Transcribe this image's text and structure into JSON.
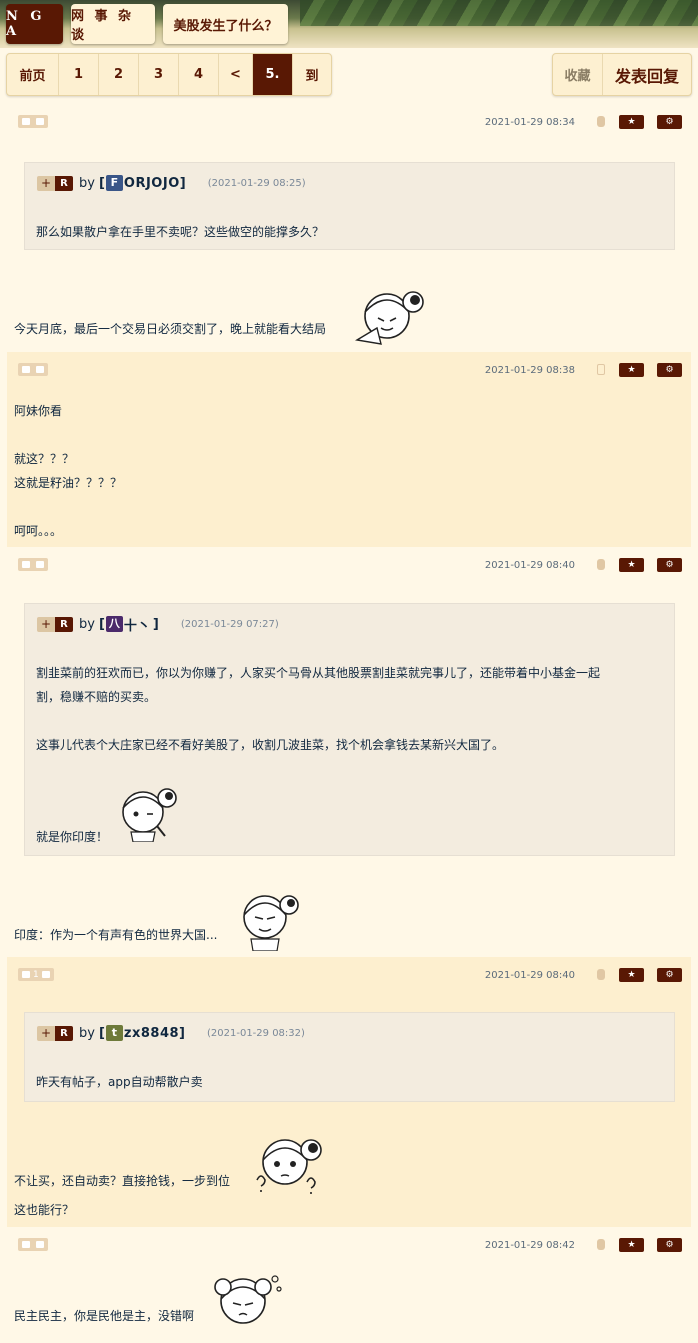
{
  "header": {
    "logo": "N G A",
    "forum": "网 事 杂 谈",
    "thread_title": "美股发生了什么？"
  },
  "pagination": {
    "items": [
      "前页",
      "1",
      "2",
      "3",
      "4",
      "<",
      "5.",
      "到"
    ],
    "active_index": 6
  },
  "thread_actions": {
    "favorite": "收藏",
    "reply": "发表回复"
  },
  "post_controls": {
    "star_icon": "star-icon",
    "gear_icon": "gear-icon",
    "thumb_icons": "thumb-up-icon / thumb-down-icon"
  },
  "quote_prefix": {
    "plus": "+",
    "reply_tag": "R",
    "by": "by",
    "open_bracket": "[",
    "close_bracket": "]"
  },
  "posts": [
    {
      "date": "2021-01-29 08:34",
      "device": "apple-icon",
      "votes": "",
      "quote": {
        "avatar_char": "F",
        "avatar_color": "#3a5688",
        "username": "ORJOJO",
        "date": "(2021-01-29 08:25)",
        "lines": [
          "那么如果散户拿在手里不卖呢？这些做空的能撑多久？"
        ]
      },
      "body": [
        "今天月底，最后一个交易日必须交割了，晚上就能看大结局"
      ]
    },
    {
      "date": "2021-01-29 08:38",
      "device": "phone-icon",
      "votes": "",
      "body": [
        "阿妹你看",
        "就这？？？",
        "这就是籽油？？？？",
        "呵呵。。。"
      ]
    },
    {
      "date": "2021-01-29 08:40",
      "device": "android-icon",
      "votes": "",
      "quote": {
        "avatar_char": "八",
        "avatar_color": "#4b2a6b",
        "username": "十丶",
        "date": "(2021-01-29 07:27)",
        "lines": [
          "割韭菜前的狂欢而已，你以为你赚了，人家买个马骨从其他股票割韭菜就完事儿了，还能带着中小基金一起",
          "割，稳赚不赔的买卖。",
          "这事儿代表个大庄家已经不看好美股了，收割几波韭菜，找个机会拿钱去某新兴大国了。",
          "就是你印度！"
        ]
      },
      "body": [
        "印度：作为一个有声有色的世界大国..."
      ]
    },
    {
      "date": "2021-01-29 08:40",
      "device": "apple-icon",
      "votes": "1",
      "quote": {
        "avatar_char": "t",
        "avatar_color": "#6e7a3a",
        "username": "zx8848",
        "date": "(2021-01-29 08:32)",
        "lines": [
          "昨天有帖子，app自动帮散户卖"
        ]
      },
      "body": [
        "不让买，还自动卖？直接抢钱，一步到位",
        "这也能行？"
      ]
    },
    {
      "date": "2021-01-29 08:42",
      "device": "android-icon",
      "votes": "",
      "body": [
        "民主民主，你是民他是主，没错啊"
      ]
    }
  ]
}
